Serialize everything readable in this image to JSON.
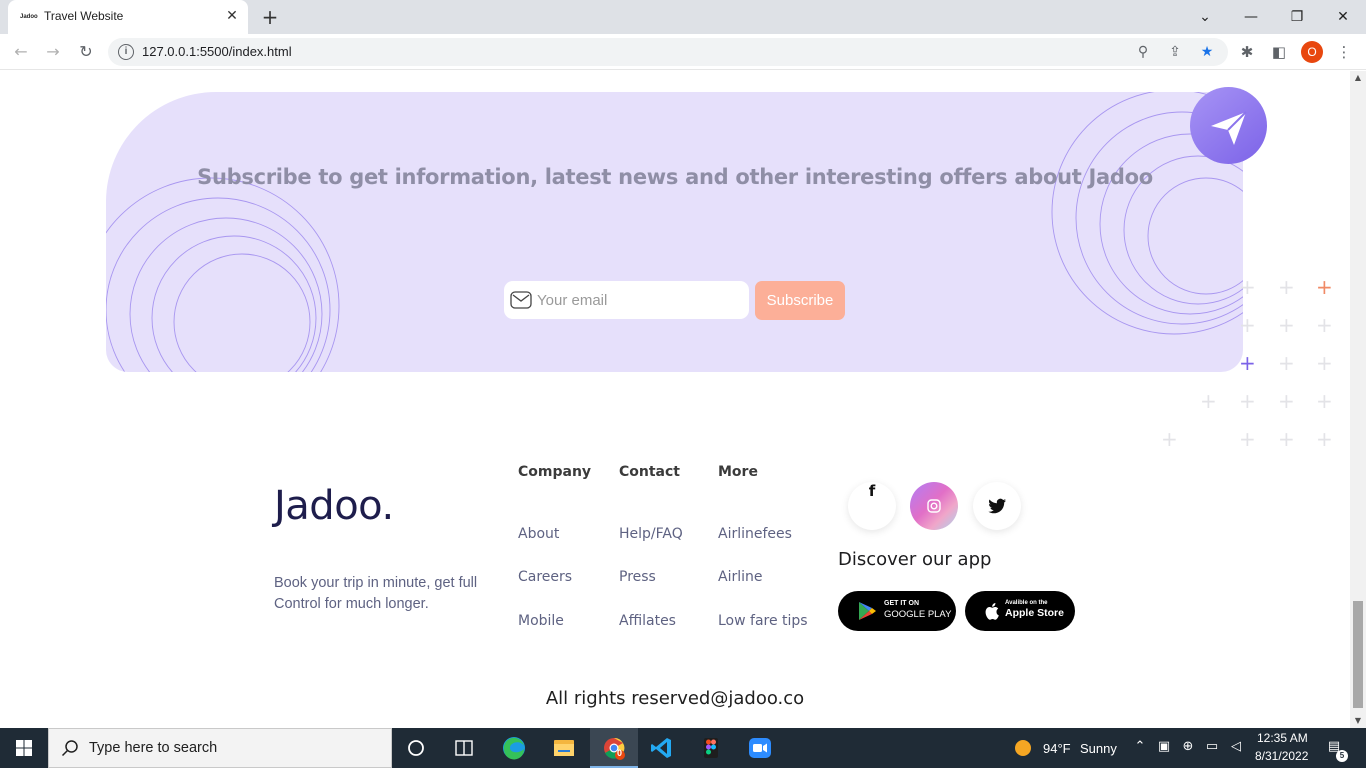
{
  "browser": {
    "tab_title": "Travel Website",
    "tab_favicon_text": "Jadoo",
    "url": "127.0.0.1:5500/index.html",
    "profile_initial": "O"
  },
  "subscribe": {
    "title": "Subscribe to get information, latest news and other interesting offers about Jadoo",
    "email_placeholder": "Your email",
    "button_label": "Subscribe"
  },
  "footer": {
    "brand": "Jadoo.",
    "tagline": "Book your trip in minute, get full Control for much longer.",
    "columns": [
      {
        "heading": "Company",
        "links": [
          "About",
          "Careers",
          "Mobile"
        ]
      },
      {
        "heading": "Contact",
        "links": [
          "Help/FAQ",
          "Press",
          "Affilates"
        ]
      },
      {
        "heading": "More",
        "links": [
          "Airlinefees",
          "Airline",
          "Low fare tips"
        ]
      }
    ],
    "social": {
      "facebook": "f"
    },
    "discover_title": "Discover our app",
    "google_play": {
      "small": "GET IT ON",
      "big": "GOOGLE PLAY"
    },
    "app_store": {
      "small": "Avalible on the",
      "big": "Apple Store"
    },
    "rights": "All rights reserved@jadoo.co"
  },
  "taskbar": {
    "search_placeholder": "Type here to search",
    "weather_temp": "94°F",
    "weather_desc": "Sunny",
    "time": "12:35 AM",
    "date": "8/31/2022",
    "chrome_badge": "0",
    "notification_count": "5"
  },
  "colors": {
    "subscribe_bg": "#e6e0fb",
    "subscribe_button": "#fcaf98",
    "brand_text": "#1e1d4c",
    "accent_purple": "#7c63e8",
    "accent_orange": "#f08a66",
    "taskbar_bg": "#1f2b36"
  }
}
